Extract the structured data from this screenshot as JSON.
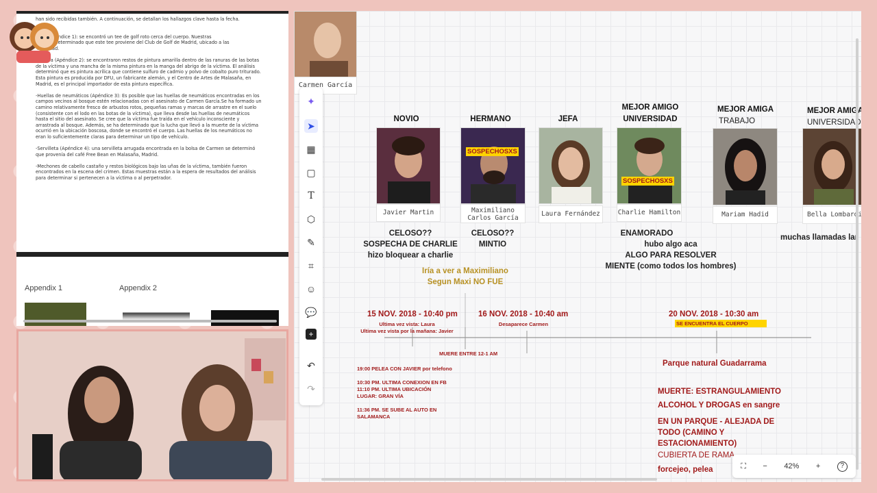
{
  "document": {
    "paragraphs": [
      "han sido recibidas también. A continuación, se detallan los hallazgos clave hasta la fecha.",
      "clave:\n roto (Apéndice 1): se encontró un tee de golf roto cerca del cuerpo. Nuestras\nnes han determinado que este tee proviene del Club de Golf de Madrid, ubicado a las\n la ciudad.",
      "-Pintura (Apéndice 2): se encontraron restos de pintura amarilla dentro de las ranuras de las botas\nde la víctima y una mancha de la misma pintura en la manga del abrigo de la víctima. El análisis\ndeterminó que es pintura acrílica que contiene sulfuro de cadmio y polvo de cobalto puro triturado.\nEsta pintura es producida por DFU, un fabricante alemán, y el Centro de Artes de Malasaña, en\nMadrid, es el principal importador de esta pintura específica.",
      "-Huellas de neumáticos (Apéndice 3): Es posible que las huellas de neumáticos encontradas en los\ncampos vecinos al bosque estén relacionadas con el asesinato de Carmen García.Se ha formado un\ncamino relativamente fresco de arbustos rotos, pequeñas ramas y marcas de arrastre en el suelo\n(consistente con el lodo en las botas de la víctima), que lleva desde las huellas de neumáticos\nhasta el sitio del asesinato. Se cree que la víctima fue traída en el vehículo inconsciente y\narrastrada al bosque. Además, se ha determinado que la lucha que llevó a la muerte de la víctima\nocurrió en la ubicación boscosa, donde se encontró el cuerpo. Las huellas de los neumáticos no\neran lo suficientemente claras para determinar un tipo de vehículo.",
      "-Servilleta (Apéndice 4): una servilleta arrugada encontrada en la bolsa de Carmen se determinó\nque provenía del café Free Bean en Malasaña, Madrid.",
      "-Mechones de cabello castaño y restos biológicos bajo las uñas de la víctima, también fueron\nencontrados en la escena del crimen. Estas muestras están a la espera de resultados del análisis\npara determinar si pertenecen a la víctima o al perpetrador."
    ],
    "appendix": [
      "Appendix 1",
      "Appendix 2"
    ]
  },
  "board": {
    "victim_caption": "Carmen García",
    "people": [
      {
        "role": "NOVIO",
        "subrole": "",
        "caption": "Javier Martin",
        "tag": ""
      },
      {
        "role": "HERMANO",
        "subrole": "",
        "caption": "Maximiliano\nCarlos García",
        "tag": "SOSPECHOSXS"
      },
      {
        "role": "JEFA",
        "subrole": "",
        "caption": "Laura Fernández",
        "tag": ""
      },
      {
        "role": "MEJOR AMIGO",
        "subrole": "UNIVERSIDAD",
        "caption": "Charlie Hamilton",
        "tag": "SOSPECHOSXS"
      },
      {
        "role": "MEJOR AMIGA",
        "subrole": "TRABAJO",
        "caption": "Mariam Hadid",
        "tag": ""
      },
      {
        "role": "MEJOR AMIGA",
        "subrole": "UNIVERSIDAD",
        "caption": "Bella Lombardi",
        "tag": ""
      }
    ],
    "notes": {
      "javier": "CELOSO??\nSOSPECHA DE CHARLIE\nhizo bloquear a charlie",
      "maxi": "CELOSO??\nMINTIO",
      "charlie_bold": "ENAMORADO",
      "charlie": "hubo algo aca\nALGO PARA RESOLVER\nMIENTE (como todos los hombres)",
      "bella": "muchas llamadas lar",
      "maxi_gold": "Iría a ver a Maximiliano\nSegun Maxi NO FUE"
    },
    "timeline": {
      "d1": "15 NOV. 2018 - 10:40 pm",
      "d1_sub": "Ultima vez vista: Laura\nUltima vez vista por la mañana: Javier",
      "d2": "16 NOV. 2018 - 10:40 am",
      "d2_sub": "Desaparece Carmen",
      "d3": "20 NOV. 2018 - 10:30 am",
      "d3_tag": "SE ENCUENTRA EL CUERPO",
      "death": "MUERE ENTRE 12-1 AM",
      "events": "19:00 PELEA CON JAVIER por telefono\n\n10:30 PM. ULTIMA CONEXION EN FB\n11:10 PM. ULTIMA UBICACIÓN\nLUGAR: GRAN VÍA\n\n11:36 PM. SE SUBE AL AUTO EN\nSALAMANCA",
      "place": "Parque natural Guadarrama",
      "cause1": "MUERTE: ESTRANGULAMIENTO",
      "cause2": "ALCOHOL Y DROGAS en sangre",
      "cause3": "EN UN PARQUE - ALEJADA DE\nTODO (CAMINO Y\nESTACIONAMIENTO)",
      "cause4": "CUBIERTA DE RAMAS",
      "cause5": "forcejeo, pelea"
    },
    "zoom": "42%"
  },
  "colors": {
    "accent_red": "#a11a1a",
    "highlight": "#ffd400",
    "gold": "#b89225",
    "tool_active": "#2f4fe6"
  }
}
